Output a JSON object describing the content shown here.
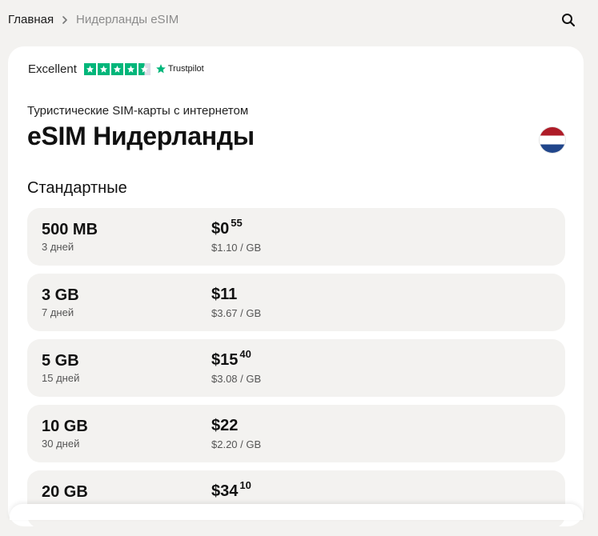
{
  "breadcrumb": {
    "home": "Главная",
    "current": "Нидерланды eSIM"
  },
  "trustpilot": {
    "rating_word": "Excellent",
    "brand": "Trustpilot",
    "stars": 4.5
  },
  "header": {
    "subtitle": "Туристические SIM-карты с интернетом",
    "title": "eSIM Нидерланды"
  },
  "section": {
    "title": "Стандартные"
  },
  "plans": [
    {
      "data": "500 MB",
      "days": "3 дней",
      "price_main": "$0",
      "price_cents": "55",
      "per_gb": "$1.10 / GB"
    },
    {
      "data": "3 GB",
      "days": "7 дней",
      "price_main": "$11",
      "price_cents": "",
      "per_gb": "$3.67 / GB"
    },
    {
      "data": "5 GB",
      "days": "15 дней",
      "price_main": "$15",
      "price_cents": "40",
      "per_gb": "$3.08 / GB"
    },
    {
      "data": "10 GB",
      "days": "30 дней",
      "price_main": "$22",
      "price_cents": "",
      "per_gb": "$2.20 / GB"
    },
    {
      "data": "20 GB",
      "days": "",
      "price_main": "$34",
      "price_cents": "10",
      "per_gb": ""
    }
  ],
  "colors": {
    "trustpilot_green": "#00b67a",
    "flag_red": "#ae1c28",
    "flag_blue": "#21468b",
    "page_bg": "#f3f2f0"
  },
  "icons": {
    "search": "search-icon",
    "separator": "chevron-right-icon",
    "flag": "netherlands-flag-icon"
  }
}
